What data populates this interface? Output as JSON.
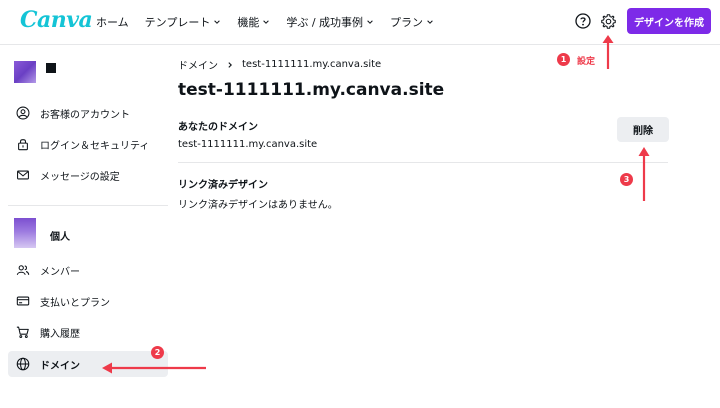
{
  "header": {
    "logo": "Canva",
    "nav": [
      {
        "label": "ホーム",
        "has_menu": false
      },
      {
        "label": "テンプレート",
        "has_menu": true
      },
      {
        "label": "機能",
        "has_menu": true
      },
      {
        "label": "学ぶ / 成功事例",
        "has_menu": true
      },
      {
        "label": "プラン",
        "has_menu": true
      }
    ],
    "create_button": "デザインを作成",
    "help_icon": "help-circle-icon",
    "settings_icon": "gear-icon"
  },
  "sidebar": {
    "account_items": [
      {
        "label": "お客様のアカウント",
        "icon": "user-circle-icon"
      },
      {
        "label": "ログイン＆セキュリティ",
        "icon": "lock-icon"
      },
      {
        "label": "メッセージの設定",
        "icon": "envelope-icon"
      }
    ],
    "team_name": "個人",
    "team_items": [
      {
        "label": "メンバー",
        "icon": "people-icon",
        "active": false
      },
      {
        "label": "支払いとプラン",
        "icon": "credit-card-icon",
        "active": false
      },
      {
        "label": "購入履歴",
        "icon": "cart-icon",
        "active": false
      },
      {
        "label": "ドメイン",
        "icon": "globe-icon",
        "active": true
      }
    ]
  },
  "main": {
    "breadcrumb": [
      "ドメイン",
      "test-1111111.my.canva.site"
    ],
    "title": "test-1111111.my.canva.site",
    "your_domain_label": "あなたのドメイン",
    "your_domain_value": "test-1111111.my.canva.site",
    "delete_button": "削除",
    "linked_label": "リンク済みデザイン",
    "linked_value": "リンク済みデザインはありません。"
  },
  "annotations": {
    "step1": {
      "number": "1",
      "text": "設定"
    },
    "step2": {
      "number": "2"
    },
    "step3": {
      "number": "3"
    },
    "color": "#ee3a4a"
  },
  "colors": {
    "brand_purple": "#7d2ae8",
    "logo_teal": "#14c4d6",
    "active_bg": "#eceef1"
  }
}
